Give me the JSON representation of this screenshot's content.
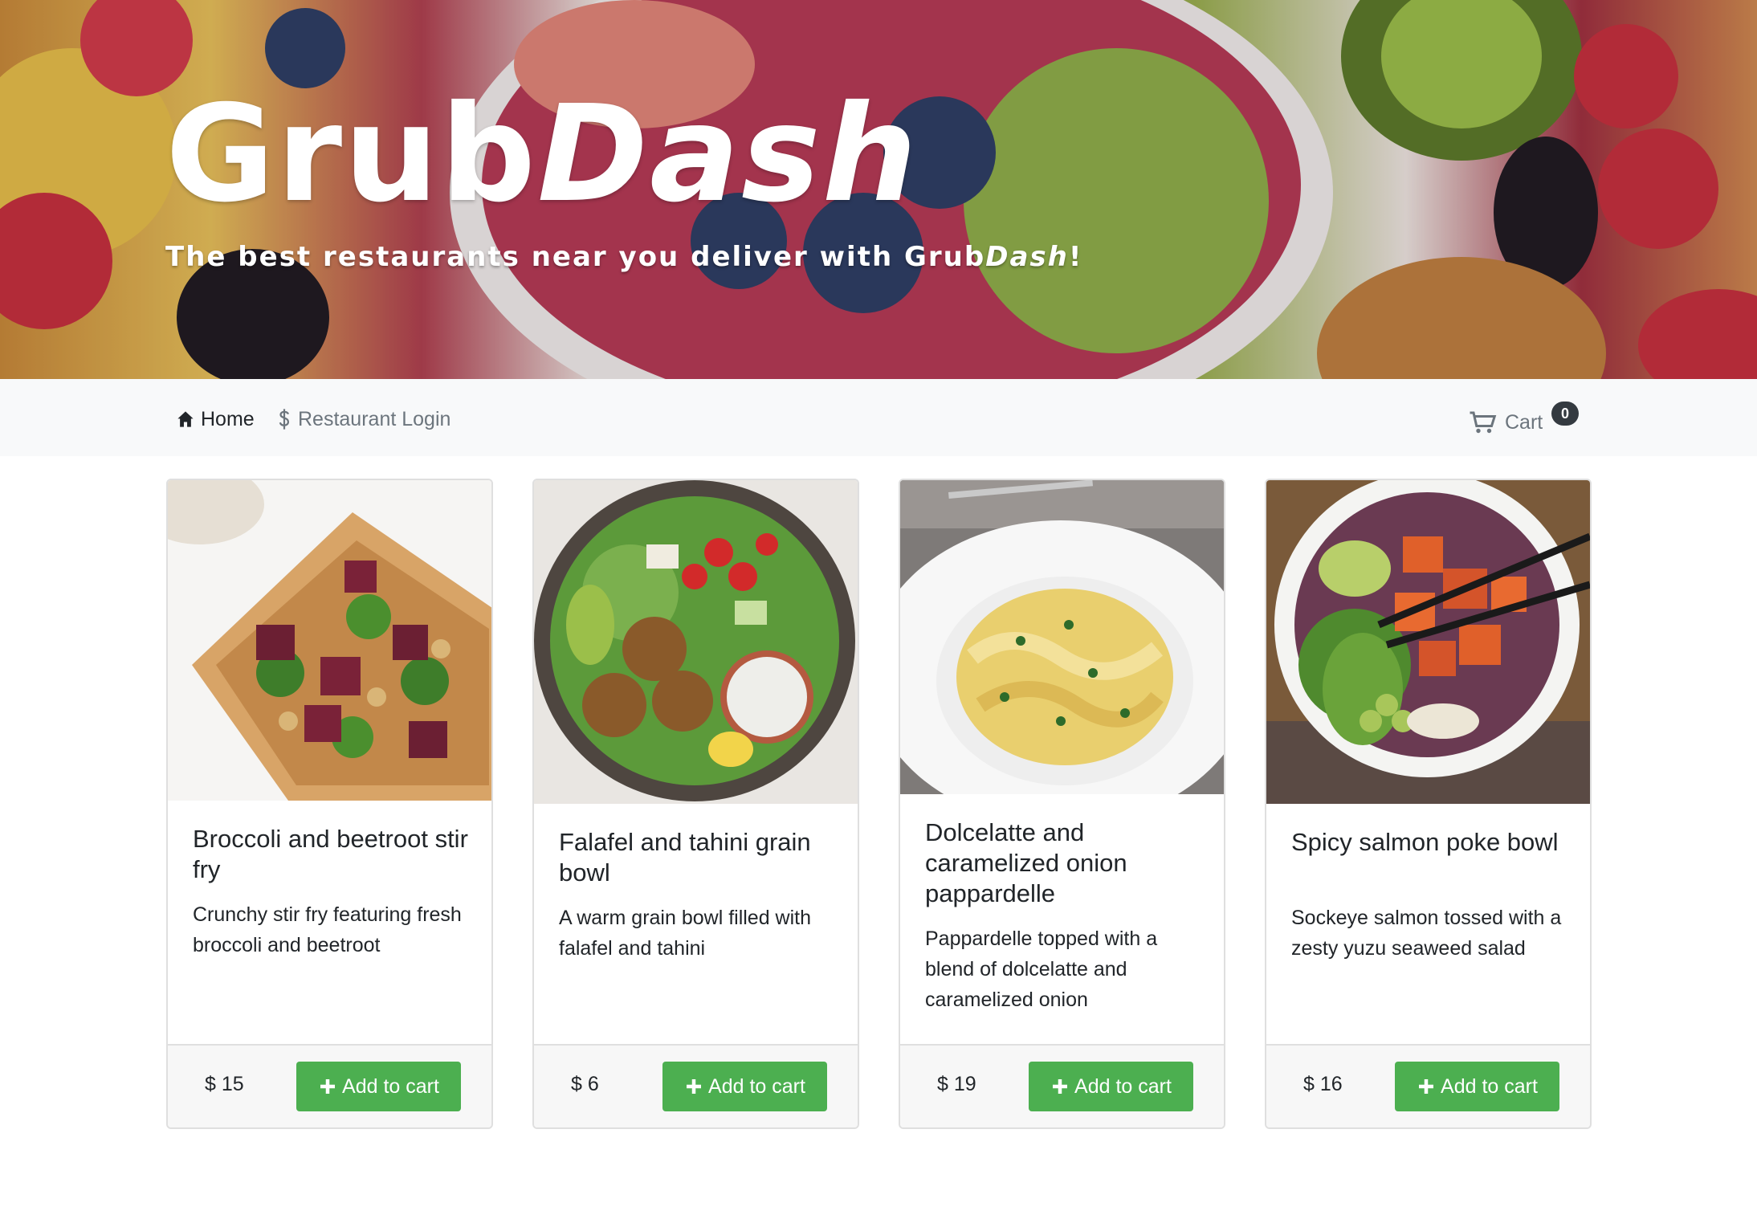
{
  "hero": {
    "title_plain": "Grub",
    "title_italic": "Dash",
    "tagline_plain": "The best restaurants near you deliver with Grub",
    "tagline_italic": "Dash",
    "tagline_end": "!"
  },
  "navbar": {
    "home_label": "Home",
    "home_icon": "home-icon",
    "login_label": "Restaurant Login",
    "login_icon": "dollar-icon",
    "cart_label": "Cart",
    "cart_icon": "cart-icon",
    "cart_count": "0"
  },
  "colors": {
    "add_button": "#4caf50",
    "navbar_bg": "#f8f9fa",
    "badge_bg": "#343a40"
  },
  "dishes": [
    {
      "name": "Broccoli and beetroot stir fry",
      "description": "Crunchy stir fry featuring fresh broccoli and beetroot",
      "price": "$ 15",
      "button_label": "Add to cart"
    },
    {
      "name": "Falafel and tahini grain bowl",
      "description": "A warm grain bowl filled with falafel and tahini",
      "price": "$ 6",
      "button_label": "Add to cart"
    },
    {
      "name": "Dolcelatte and caramelized onion pappardelle",
      "description": "Pappardelle topped with a blend of dolcelatte and caramelized onion",
      "price": "$ 19",
      "button_label": "Add to cart"
    },
    {
      "name": "Spicy salmon poke bowl",
      "description": "Sockeye salmon tossed with a zesty yuzu seaweed salad",
      "price": "$ 16",
      "button_label": "Add to cart"
    }
  ]
}
